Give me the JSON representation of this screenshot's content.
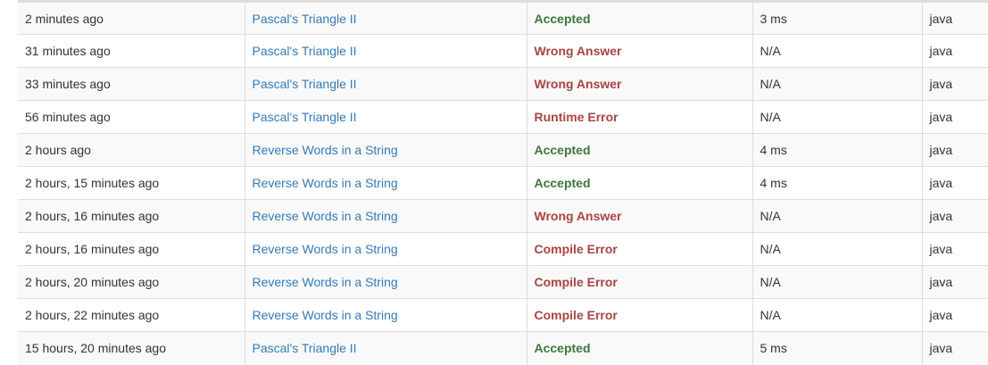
{
  "colors": {
    "accepted": "#3c763d",
    "error": "#a94442",
    "link": "#337ab7",
    "stripe": "#f9f9f9",
    "border": "#dddddd"
  },
  "submissions": [
    {
      "time": "2 minutes ago",
      "problem": "Pascal's Triangle II",
      "status": "Accepted",
      "runtime": "3 ms",
      "language": "java"
    },
    {
      "time": "31 minutes ago",
      "problem": "Pascal's Triangle II",
      "status": "Wrong Answer",
      "runtime": "N/A",
      "language": "java"
    },
    {
      "time": "33 minutes ago",
      "problem": "Pascal's Triangle II",
      "status": "Wrong Answer",
      "runtime": "N/A",
      "language": "java"
    },
    {
      "time": "56 minutes ago",
      "problem": "Pascal's Triangle II",
      "status": "Runtime Error",
      "runtime": "N/A",
      "language": "java"
    },
    {
      "time": "2 hours ago",
      "problem": "Reverse Words in a String",
      "status": "Accepted",
      "runtime": "4 ms",
      "language": "java"
    },
    {
      "time": "2 hours, 15 minutes ago",
      "problem": "Reverse Words in a String",
      "status": "Accepted",
      "runtime": "4 ms",
      "language": "java"
    },
    {
      "time": "2 hours, 16 minutes ago",
      "problem": "Reverse Words in a String",
      "status": "Wrong Answer",
      "runtime": "N/A",
      "language": "java"
    },
    {
      "time": "2 hours, 16 minutes ago",
      "problem": "Reverse Words in a String",
      "status": "Compile Error",
      "runtime": "N/A",
      "language": "java"
    },
    {
      "time": "2 hours, 20 minutes ago",
      "problem": "Reverse Words in a String",
      "status": "Compile Error",
      "runtime": "N/A",
      "language": "java"
    },
    {
      "time": "2 hours, 22 minutes ago",
      "problem": "Reverse Words in a String",
      "status": "Compile Error",
      "runtime": "N/A",
      "language": "java"
    },
    {
      "time": "15 hours, 20 minutes ago",
      "problem": "Pascal's Triangle II",
      "status": "Accepted",
      "runtime": "5 ms",
      "language": "java"
    }
  ]
}
